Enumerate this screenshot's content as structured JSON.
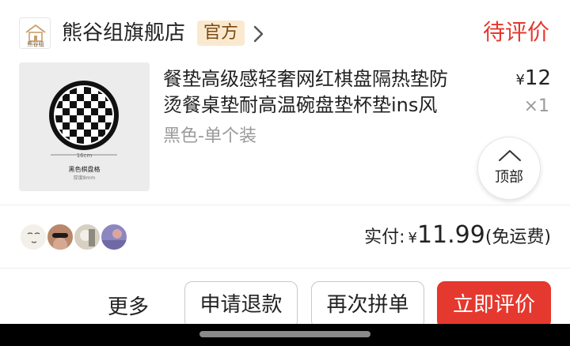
{
  "store": {
    "logo_text": "熊谷组",
    "name": "熊谷组旗舰店",
    "badge": "官方",
    "chevron_icon": "chevron-right-icon"
  },
  "order": {
    "status": "待评价"
  },
  "product": {
    "title_line1": "餐垫高级感轻奢网红棋盘隔热垫防",
    "title_line2": "烫餐桌垫耐高温碗盘垫杯垫ins风",
    "variant": "黑色-单个装",
    "image": {
      "size_label": "16cm",
      "caption": "黑色棋盘格",
      "subcaption": "厚度8mm"
    },
    "price_symbol": "¥",
    "price": "12",
    "quantity": "×1"
  },
  "back_to_top": {
    "label": "顶部",
    "icon": "chevron-up-icon"
  },
  "summary": {
    "paid_label": "实付:",
    "currency": "¥",
    "amount": "11.99",
    "shipping_note": "(免运费)"
  },
  "actions": {
    "more": "更多",
    "refund": "申请退款",
    "rebuy": "再次拼单",
    "review": "立即评价"
  },
  "colors": {
    "accent": "#e5382e",
    "badge_bg": "#fbe9cf",
    "badge_text": "#7a4a12",
    "muted_text": "#9a9a9a"
  }
}
